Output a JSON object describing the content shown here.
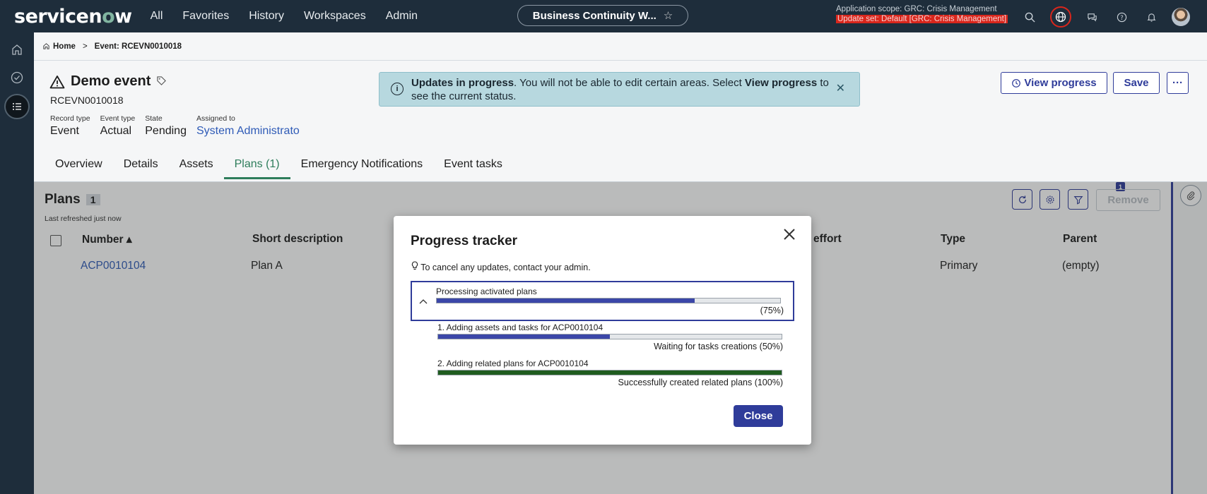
{
  "topbar": {
    "logo_pre": "servicen",
    "logo_o": "o",
    "logo_post": "w",
    "nav": [
      "All",
      "Favorites",
      "History",
      "Workspaces",
      "Admin"
    ],
    "workspace": "Business Continuity W...",
    "scope_line": "Application scope: GRC: Crisis Management",
    "update_set": "Update set: Default [GRC: Crisis Management]"
  },
  "breadcrumb": {
    "home": "Home",
    "sep": ">",
    "current": "Event: RCEVN0010018"
  },
  "record": {
    "title": "Demo event",
    "number": "RCEVN0010018",
    "fields": [
      {
        "label": "Record type",
        "value": "Event"
      },
      {
        "label": "Event type",
        "value": "Actual"
      },
      {
        "label": "State",
        "value": "Pending"
      },
      {
        "label": "Assigned to",
        "value": "System Administrato"
      }
    ],
    "tabs": [
      "Overview",
      "Details",
      "Assets",
      "Plans (1)",
      "Emergency Notifications",
      "Event tasks"
    ],
    "active_tab": "Plans (1)"
  },
  "banner": {
    "bold1": "Updates in progress",
    "text1": ". You will not be able to edit certain areas. Select ",
    "bold2": "View progress",
    "text2": " to see the current status."
  },
  "header_buttons": {
    "view_progress": "View progress",
    "save": "Save",
    "more": "···"
  },
  "list": {
    "title": "Plans",
    "count": "1",
    "refreshed": "Last refreshed just now",
    "remove": "Remove",
    "filter_count": "1",
    "columns": [
      "Number ▴",
      "Short description",
      "effort",
      "Type",
      "Parent"
    ],
    "rows": [
      {
        "number": "ACP0010104",
        "short_description": "Plan A",
        "type": "Primary",
        "parent": "(empty)"
      }
    ]
  },
  "modal": {
    "title": "Progress tracker",
    "tip": "To cancel any updates, contact your admin.",
    "main": {
      "label": "Processing activated plans",
      "progress": 0.75,
      "status": "(75%)"
    },
    "steps": [
      {
        "label": "1. Adding assets and tasks for ACP0010104",
        "progress": 0.5,
        "status": "Waiting for tasks creations (50%)",
        "color": "#3b47a8"
      },
      {
        "label": "2. Adding related plans for ACP0010104",
        "progress": 1.0,
        "status": "Successfully created related plans (100%)",
        "color": "#1f5c1f"
      }
    ],
    "close_button": "Close"
  },
  "colors": {
    "topbar": "#1e2d3b",
    "accent": "#2f3c9a",
    "tab_active": "#2e7d5b",
    "update_set_bg": "#d9261c"
  }
}
